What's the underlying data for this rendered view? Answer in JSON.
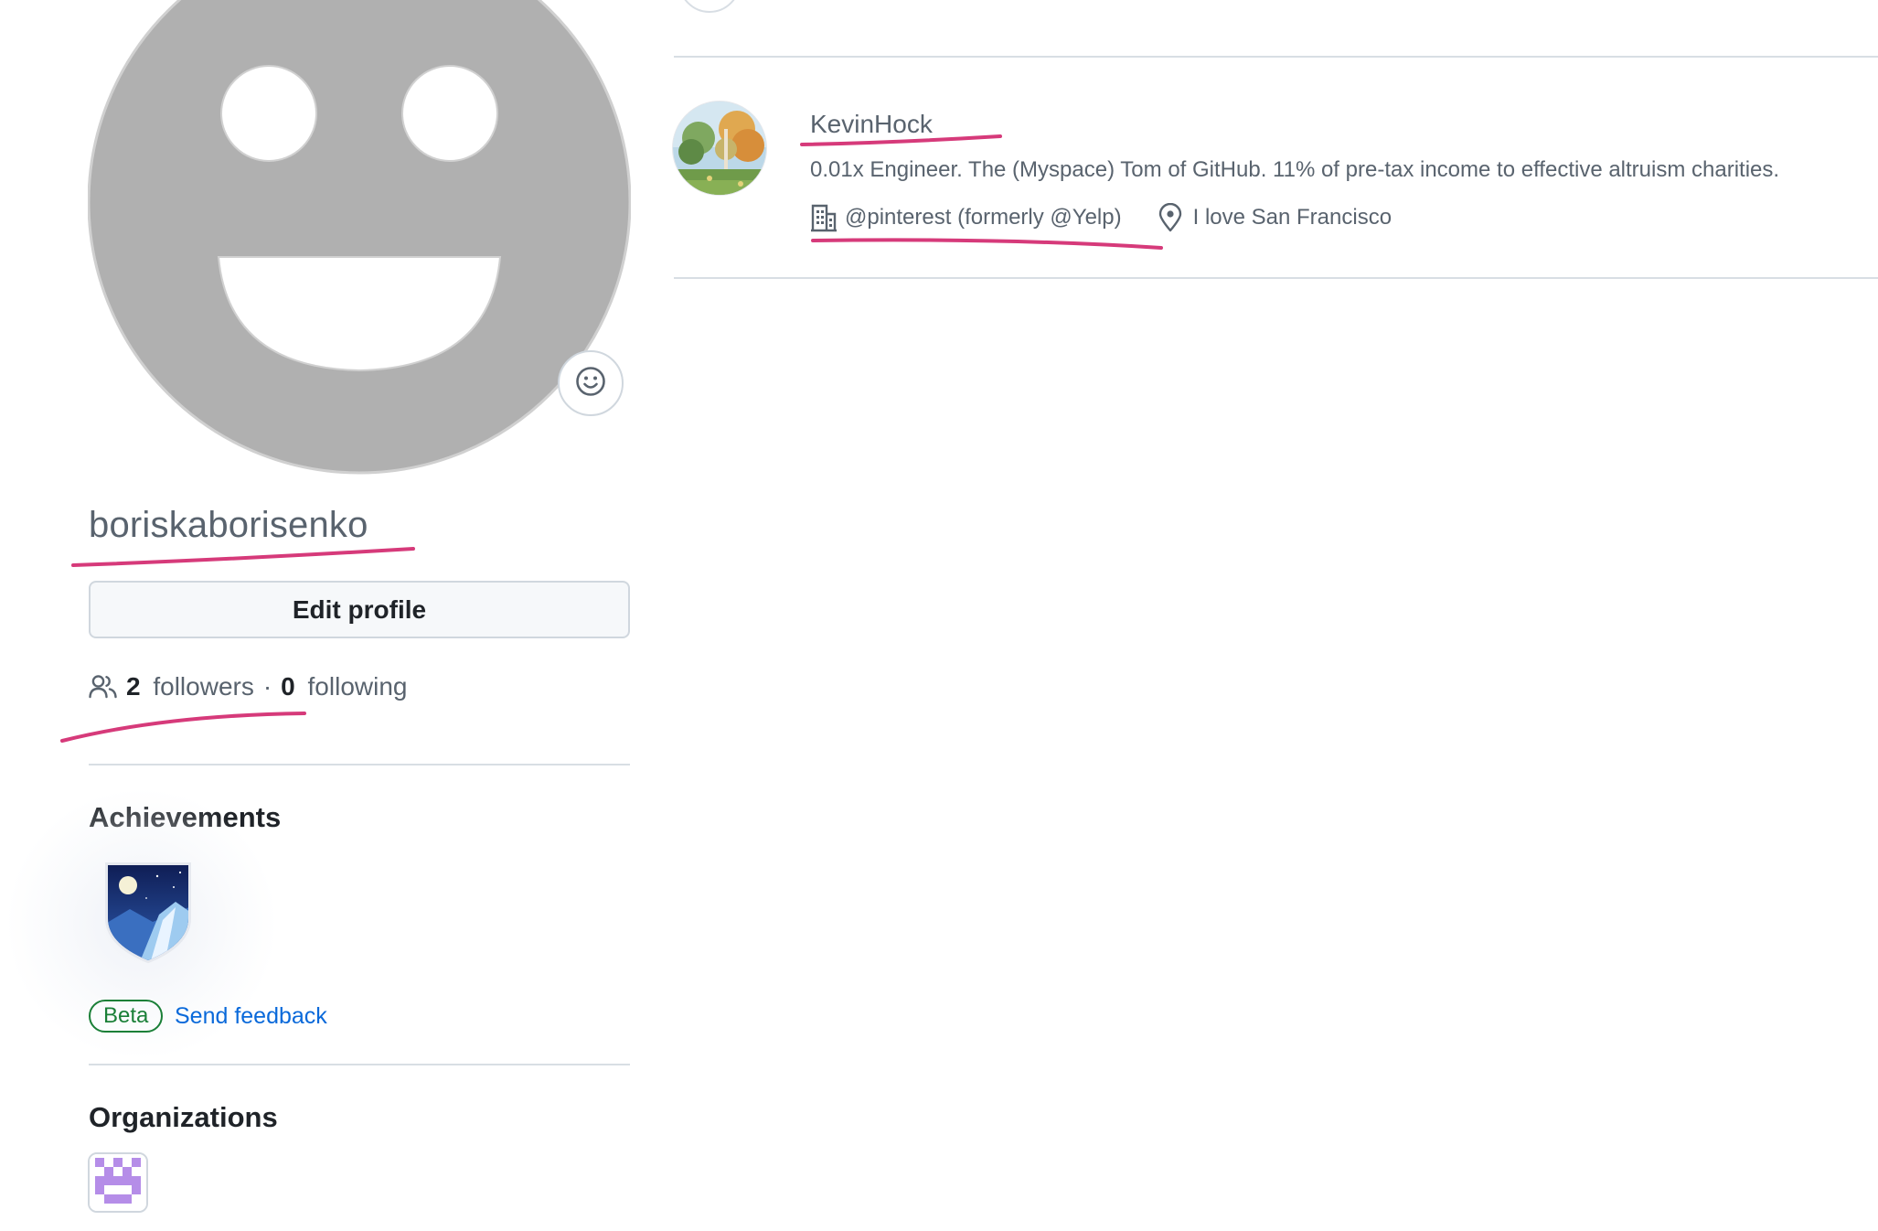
{
  "profile": {
    "username": "boriskaborisenko",
    "edit_profile_label": "Edit profile",
    "followers_count": "2",
    "followers_label": "followers",
    "separator": "·",
    "following_count": "0",
    "following_label": "following",
    "status_icon": "smiley-icon",
    "avatar_icon": "default-smiley-avatar"
  },
  "achievements": {
    "title": "Achievements",
    "badge_icon": "night-mountain-shield-badge",
    "beta_label": "Beta",
    "feedback_label": "Send feedback"
  },
  "organizations": {
    "title": "Organizations",
    "org_icon": "purple-pixel-identicon"
  },
  "following_list": [
    {
      "name": "KevinHock",
      "bio": "0.01x Engineer. The (Myspace) Tom of GitHub. 11% of pre-tax income to effective altruism charities.",
      "company": "@pinterest (formerly @Yelp)",
      "location": "I love San Francisco",
      "company_icon": "organization-icon",
      "location_icon": "location-pin-icon",
      "avatar_icon": "landscape-painting-avatar"
    }
  ],
  "colors": {
    "text_primary": "#1f2328",
    "text_muted": "#59636e",
    "link": "#0969da",
    "beta_green": "#1a7f37",
    "border": "#d0d7de",
    "annotation_pink": "#d63a7a",
    "avatar_gray": "#b0b0b0",
    "org_purple": "#b58de8"
  }
}
